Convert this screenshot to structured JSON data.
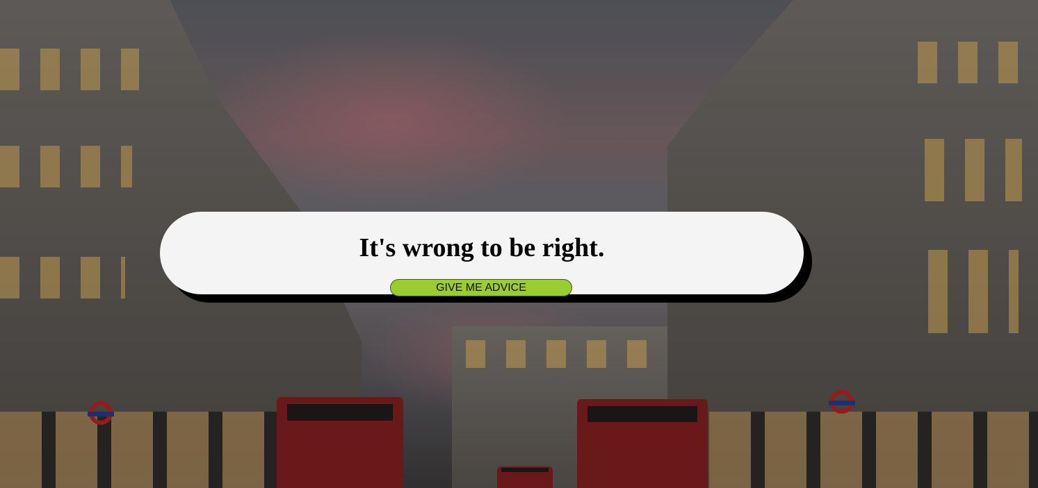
{
  "advice": {
    "text": "It's wrong to be right.",
    "button_label": "GIVE ME ADVICE"
  },
  "colors": {
    "card_background": "#f4f4f4",
    "card_shadow": "#000000",
    "button_background": "#9acd32",
    "text": "#000000"
  }
}
